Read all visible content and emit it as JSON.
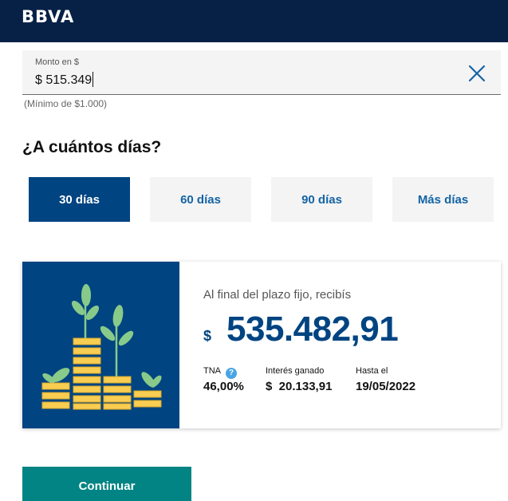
{
  "header": {
    "logo_text": "BBVA"
  },
  "amount": {
    "label": "Monto en $",
    "value": "$ 515.349",
    "hint": "(Mínimo de $1.000)"
  },
  "icons": {
    "clear": "close-icon",
    "help": "question-mark-icon",
    "illustration": "coins-plants-illustration"
  },
  "days": {
    "question": "¿A cuántos días?",
    "options": [
      {
        "label": "30 días",
        "selected": true
      },
      {
        "label": "60 días",
        "selected": false
      },
      {
        "label": "90 días",
        "selected": false
      },
      {
        "label": "Más días",
        "selected": false
      }
    ]
  },
  "result": {
    "subtitle": "Al final del plazo fijo, recibís",
    "currency": "$",
    "amount": "535.482,91",
    "help_glyph": "?",
    "tna": {
      "label": "TNA",
      "value": "46,00%"
    },
    "interest": {
      "label": "Interés ganado",
      "value": "$  20.133,91"
    },
    "until": {
      "label": "Hasta el",
      "value": "19/05/2022"
    }
  },
  "actions": {
    "continue_label": "Continuar"
  },
  "colors": {
    "navy": "#072146",
    "primary": "#004481",
    "link_blue": "#1464a5",
    "teal": "#028484",
    "coin_gold": "#f8cd51",
    "leaf_green": "#88ca8a",
    "light_bg": "#f4f4f4"
  }
}
